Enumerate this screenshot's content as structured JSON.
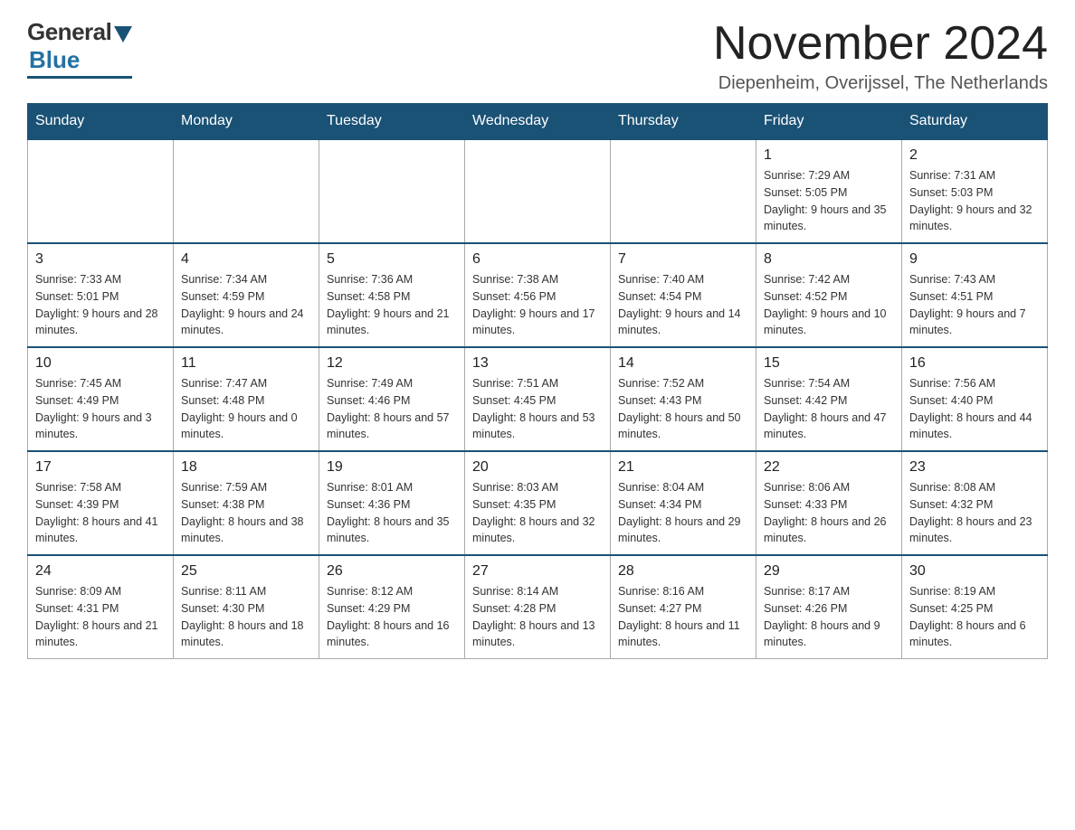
{
  "header": {
    "logo_general": "General",
    "logo_blue": "Blue",
    "month_title": "November 2024",
    "location": "Diepenheim, Overijssel, The Netherlands"
  },
  "days_of_week": [
    "Sunday",
    "Monday",
    "Tuesday",
    "Wednesday",
    "Thursday",
    "Friday",
    "Saturday"
  ],
  "weeks": [
    {
      "days": [
        {
          "number": "",
          "info": "",
          "empty": true
        },
        {
          "number": "",
          "info": "",
          "empty": true
        },
        {
          "number": "",
          "info": "",
          "empty": true
        },
        {
          "number": "",
          "info": "",
          "empty": true
        },
        {
          "number": "",
          "info": "",
          "empty": true
        },
        {
          "number": "1",
          "info": "Sunrise: 7:29 AM\nSunset: 5:05 PM\nDaylight: 9 hours and 35 minutes.",
          "empty": false
        },
        {
          "number": "2",
          "info": "Sunrise: 7:31 AM\nSunset: 5:03 PM\nDaylight: 9 hours and 32 minutes.",
          "empty": false
        }
      ]
    },
    {
      "days": [
        {
          "number": "3",
          "info": "Sunrise: 7:33 AM\nSunset: 5:01 PM\nDaylight: 9 hours and 28 minutes.",
          "empty": false
        },
        {
          "number": "4",
          "info": "Sunrise: 7:34 AM\nSunset: 4:59 PM\nDaylight: 9 hours and 24 minutes.",
          "empty": false
        },
        {
          "number": "5",
          "info": "Sunrise: 7:36 AM\nSunset: 4:58 PM\nDaylight: 9 hours and 21 minutes.",
          "empty": false
        },
        {
          "number": "6",
          "info": "Sunrise: 7:38 AM\nSunset: 4:56 PM\nDaylight: 9 hours and 17 minutes.",
          "empty": false
        },
        {
          "number": "7",
          "info": "Sunrise: 7:40 AM\nSunset: 4:54 PM\nDaylight: 9 hours and 14 minutes.",
          "empty": false
        },
        {
          "number": "8",
          "info": "Sunrise: 7:42 AM\nSunset: 4:52 PM\nDaylight: 9 hours and 10 minutes.",
          "empty": false
        },
        {
          "number": "9",
          "info": "Sunrise: 7:43 AM\nSunset: 4:51 PM\nDaylight: 9 hours and 7 minutes.",
          "empty": false
        }
      ]
    },
    {
      "days": [
        {
          "number": "10",
          "info": "Sunrise: 7:45 AM\nSunset: 4:49 PM\nDaylight: 9 hours and 3 minutes.",
          "empty": false
        },
        {
          "number": "11",
          "info": "Sunrise: 7:47 AM\nSunset: 4:48 PM\nDaylight: 9 hours and 0 minutes.",
          "empty": false
        },
        {
          "number": "12",
          "info": "Sunrise: 7:49 AM\nSunset: 4:46 PM\nDaylight: 8 hours and 57 minutes.",
          "empty": false
        },
        {
          "number": "13",
          "info": "Sunrise: 7:51 AM\nSunset: 4:45 PM\nDaylight: 8 hours and 53 minutes.",
          "empty": false
        },
        {
          "number": "14",
          "info": "Sunrise: 7:52 AM\nSunset: 4:43 PM\nDaylight: 8 hours and 50 minutes.",
          "empty": false
        },
        {
          "number": "15",
          "info": "Sunrise: 7:54 AM\nSunset: 4:42 PM\nDaylight: 8 hours and 47 minutes.",
          "empty": false
        },
        {
          "number": "16",
          "info": "Sunrise: 7:56 AM\nSunset: 4:40 PM\nDaylight: 8 hours and 44 minutes.",
          "empty": false
        }
      ]
    },
    {
      "days": [
        {
          "number": "17",
          "info": "Sunrise: 7:58 AM\nSunset: 4:39 PM\nDaylight: 8 hours and 41 minutes.",
          "empty": false
        },
        {
          "number": "18",
          "info": "Sunrise: 7:59 AM\nSunset: 4:38 PM\nDaylight: 8 hours and 38 minutes.",
          "empty": false
        },
        {
          "number": "19",
          "info": "Sunrise: 8:01 AM\nSunset: 4:36 PM\nDaylight: 8 hours and 35 minutes.",
          "empty": false
        },
        {
          "number": "20",
          "info": "Sunrise: 8:03 AM\nSunset: 4:35 PM\nDaylight: 8 hours and 32 minutes.",
          "empty": false
        },
        {
          "number": "21",
          "info": "Sunrise: 8:04 AM\nSunset: 4:34 PM\nDaylight: 8 hours and 29 minutes.",
          "empty": false
        },
        {
          "number": "22",
          "info": "Sunrise: 8:06 AM\nSunset: 4:33 PM\nDaylight: 8 hours and 26 minutes.",
          "empty": false
        },
        {
          "number": "23",
          "info": "Sunrise: 8:08 AM\nSunset: 4:32 PM\nDaylight: 8 hours and 23 minutes.",
          "empty": false
        }
      ]
    },
    {
      "days": [
        {
          "number": "24",
          "info": "Sunrise: 8:09 AM\nSunset: 4:31 PM\nDaylight: 8 hours and 21 minutes.",
          "empty": false
        },
        {
          "number": "25",
          "info": "Sunrise: 8:11 AM\nSunset: 4:30 PM\nDaylight: 8 hours and 18 minutes.",
          "empty": false
        },
        {
          "number": "26",
          "info": "Sunrise: 8:12 AM\nSunset: 4:29 PM\nDaylight: 8 hours and 16 minutes.",
          "empty": false
        },
        {
          "number": "27",
          "info": "Sunrise: 8:14 AM\nSunset: 4:28 PM\nDaylight: 8 hours and 13 minutes.",
          "empty": false
        },
        {
          "number": "28",
          "info": "Sunrise: 8:16 AM\nSunset: 4:27 PM\nDaylight: 8 hours and 11 minutes.",
          "empty": false
        },
        {
          "number": "29",
          "info": "Sunrise: 8:17 AM\nSunset: 4:26 PM\nDaylight: 8 hours and 9 minutes.",
          "empty": false
        },
        {
          "number": "30",
          "info": "Sunrise: 8:19 AM\nSunset: 4:25 PM\nDaylight: 8 hours and 6 minutes.",
          "empty": false
        }
      ]
    }
  ]
}
